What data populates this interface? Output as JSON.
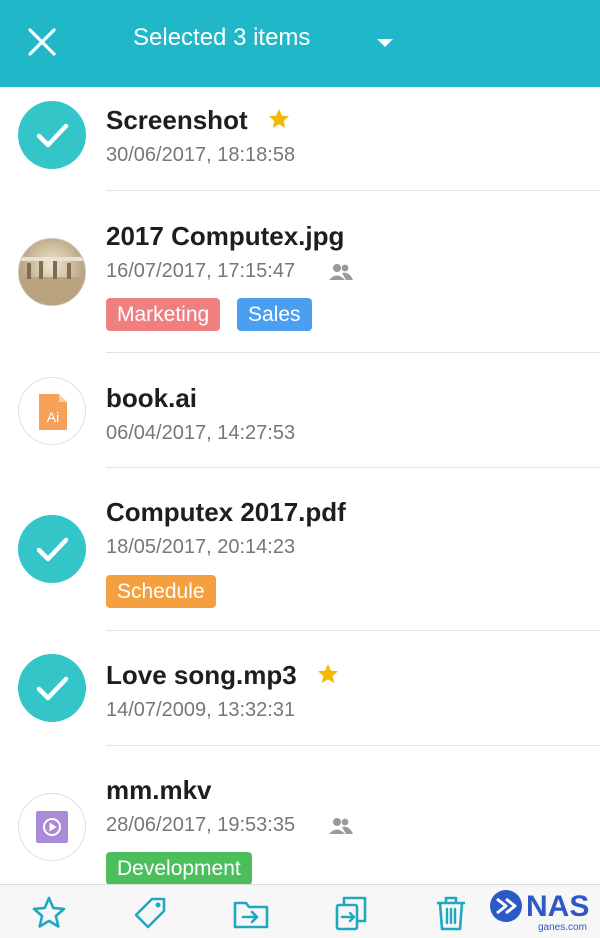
{
  "header": {
    "title": "Selected 3 items",
    "background": "#20b8c8",
    "close_icon": "close-icon",
    "dropdown_icon": "caret-down-icon"
  },
  "files": [
    {
      "name": "Screenshot",
      "date": "30/06/2017, 18:18:58",
      "selected": true,
      "starred": true,
      "shared": false,
      "tags": []
    },
    {
      "name": "2017 Computex.jpg",
      "date": "16/07/2017, 17:15:47",
      "selected": false,
      "starred": false,
      "shared": true,
      "thumbnail": "photo",
      "tags": [
        {
          "label": "Marketing",
          "color": "#f08080"
        },
        {
          "label": "Sales",
          "color": "#4a9ff0"
        }
      ]
    },
    {
      "name": "book.ai",
      "date": "06/04/2017, 14:27:53",
      "selected": false,
      "starred": false,
      "shared": false,
      "thumbnail": "ai-file-icon",
      "ai_label": "Ai",
      "tags": []
    },
    {
      "name": "Computex 2017.pdf",
      "date": "18/05/2017, 20:14:23",
      "selected": true,
      "starred": false,
      "shared": false,
      "tags": [
        {
          "label": "Schedule",
          "color": "#f5a040"
        }
      ]
    },
    {
      "name": "Love song.mp3",
      "date": "14/07/2009, 13:32:31",
      "selected": true,
      "starred": true,
      "shared": false,
      "tags": []
    },
    {
      "name": "mm.mkv",
      "date": "28/06/2017, 19:53:35",
      "selected": false,
      "starred": false,
      "shared": true,
      "thumbnail": "video-file-icon",
      "tags": [
        {
          "label": "Development",
          "color": "#4cbe5c"
        }
      ]
    }
  ],
  "bottom_bar": {
    "actions": [
      "star-icon",
      "tag-icon",
      "move-icon",
      "copy-icon",
      "trash-icon"
    ],
    "icon_color": "#20a8c0"
  },
  "watermark": {
    "text": "NAS",
    "subtext": "ganes.com"
  },
  "colors": {
    "accent": "#20b8c8",
    "checked_circle": "#33c5c8",
    "star": "#f5b800"
  }
}
